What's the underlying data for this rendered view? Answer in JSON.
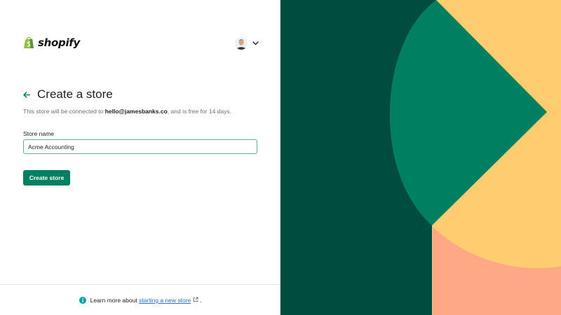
{
  "brand": {
    "name": "shopify"
  },
  "account": {
    "avatar": "user-avatar",
    "menu_icon": "chevron-down-icon"
  },
  "form": {
    "back_icon": "arrow-left-icon",
    "title": "Create a store",
    "subtitle_prefix": "This store will be connected to",
    "subtitle_email": "hello@jamesbanks.co",
    "subtitle_suffix": ", and is free for 14 days.",
    "store_name_label": "Store name",
    "store_name_value": "Acme Accounting",
    "submit_label": "Create store"
  },
  "footer": {
    "info_icon": "info-icon",
    "text_prefix": "Learn more about",
    "link_text": "starting a new store",
    "external_icon": "external-link-icon",
    "text_suffix": "."
  },
  "colors": {
    "primary": "#008060",
    "link": "#2c6ecb",
    "art_dark_green": "#004c3f",
    "art_green": "#008060",
    "art_yellow": "#ffcd6f",
    "art_peach": "#ffa886"
  }
}
